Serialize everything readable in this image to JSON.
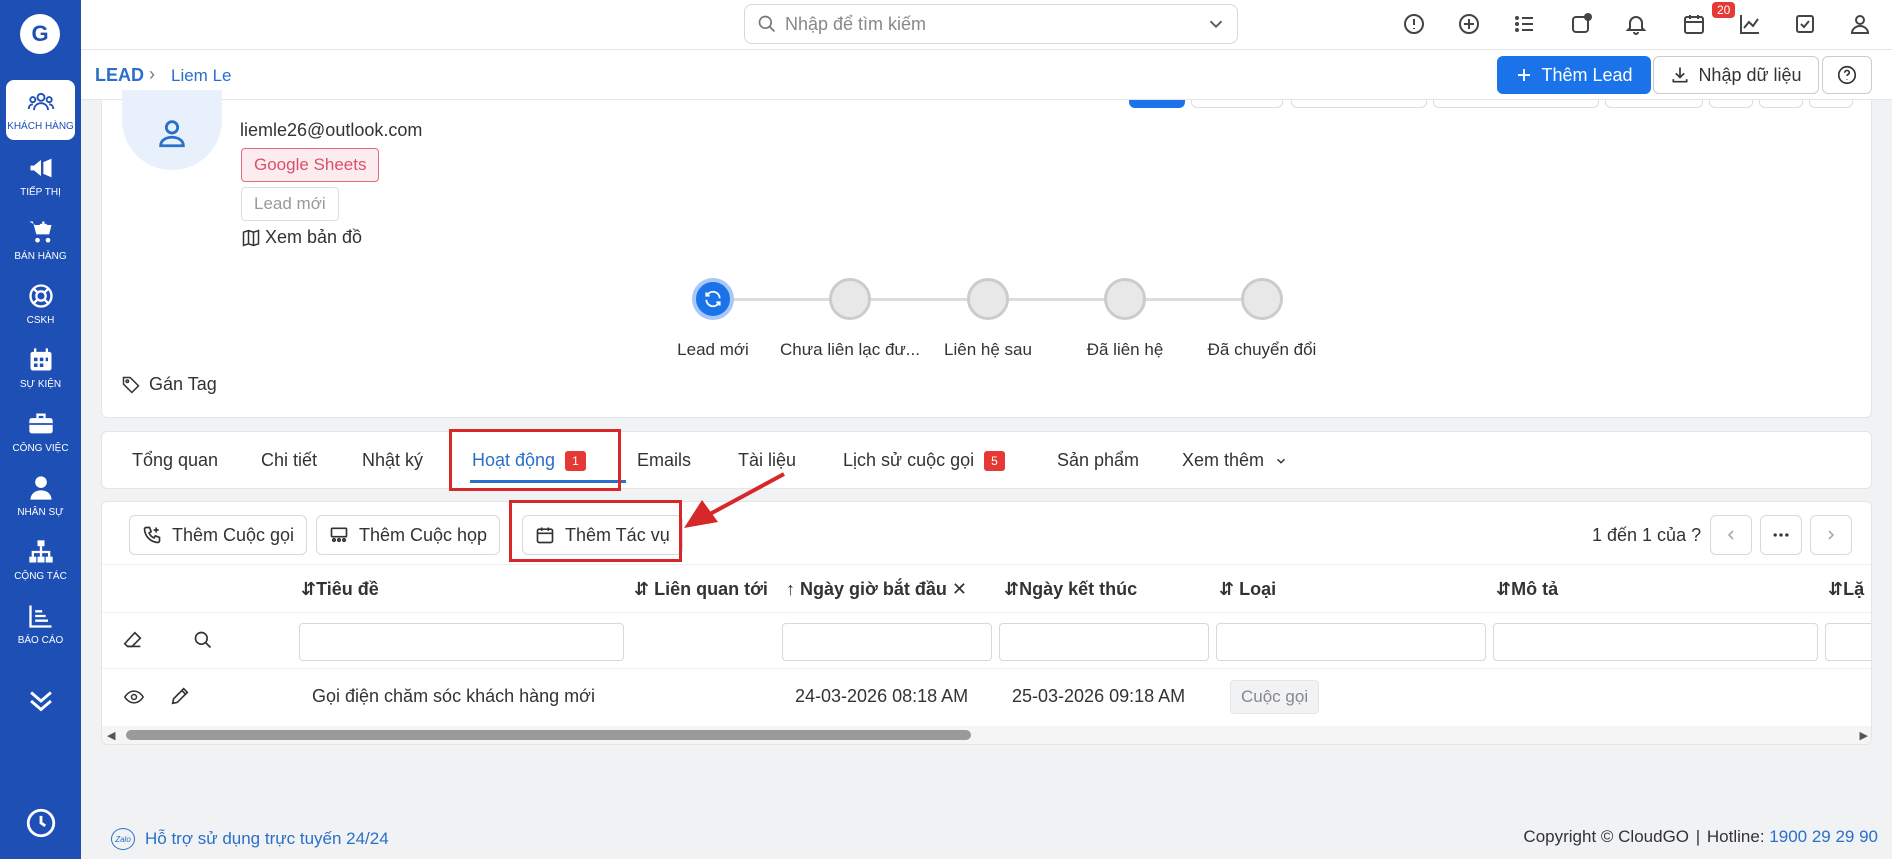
{
  "search": {
    "placeholder": "Nhập để tìm kiếm"
  },
  "notifications": {
    "count": "20"
  },
  "sidebar": {
    "items": [
      {
        "label": "KHÁCH HÀNG",
        "icon": "users-icon"
      },
      {
        "label": "TIẾP THỊ",
        "icon": "megaphone-icon"
      },
      {
        "label": "BÁN HÀNG",
        "icon": "cart-icon"
      },
      {
        "label": "CSKH",
        "icon": "lifebuoy-icon"
      },
      {
        "label": "SỰ KIỆN",
        "icon": "calendar-icon"
      },
      {
        "label": "CÔNG VIỆC",
        "icon": "briefcase-icon"
      },
      {
        "label": "NHÂN SỰ",
        "icon": "person-icon"
      },
      {
        "label": "CỘNG TÁC",
        "icon": "org-chart-icon"
      },
      {
        "label": "BÁO CÁO",
        "icon": "report-icon"
      }
    ]
  },
  "breadcrumb": {
    "module": "LEAD",
    "record": "Liem Le"
  },
  "header_actions": {
    "add_lead": "Thêm Lead",
    "import": "Nhập dữ liệu"
  },
  "profile": {
    "email": "liemle26@outlook.com",
    "source": "Google Sheets",
    "status": "Lead mới",
    "map_link": "Xem bản đồ",
    "tag_label": "Gán Tag"
  },
  "pipeline": {
    "stages": [
      "Lead mới",
      "Chưa liên lạc đư...",
      "Liên hệ sau",
      "Đã liên hệ",
      "Đã chuyển đổi"
    ],
    "active_index": 0
  },
  "tabs": {
    "overview": "Tổng quan",
    "detail": "Chi tiết",
    "log": "Nhật ký",
    "activity": "Hoạt động",
    "activity_count": "1",
    "emails": "Emails",
    "documents": "Tài liệu",
    "call_history": "Lịch sử cuộc gọi",
    "call_history_count": "5",
    "products": "Sản phẩm",
    "more": "Xem thêm"
  },
  "activity": {
    "add_call": "Thêm Cuộc gọi",
    "add_meeting": "Thêm Cuộc họp",
    "add_task": "Thêm Tác vụ",
    "pager": "1 đến 1 của",
    "pager_q": "?",
    "columns": {
      "title": "Tiêu đề",
      "related": "Liên quan tới",
      "start": "Ngày giờ bắt đầu",
      "end": "Ngày kết thúc",
      "type": "Loại",
      "desc": "Mô tả",
      "repeat": "Lặ"
    },
    "rows": [
      {
        "title": "Gọi điện chăm sóc khách hàng mới",
        "start": "24-03-2026 08:18 AM",
        "end": "25-03-2026 09:18 AM",
        "type": "Cuộc gọi"
      }
    ]
  },
  "footer": {
    "support": "Hỗ trợ sử dụng trực tuyến 24/24",
    "copyright": "Copyright © CloudGO",
    "hotline_label": "Hotline:",
    "hotline": "1900 29 29 90"
  },
  "colors": {
    "primary": "#1a73e8",
    "sidebar": "#1e4fb5",
    "highlight": "#d62828"
  }
}
